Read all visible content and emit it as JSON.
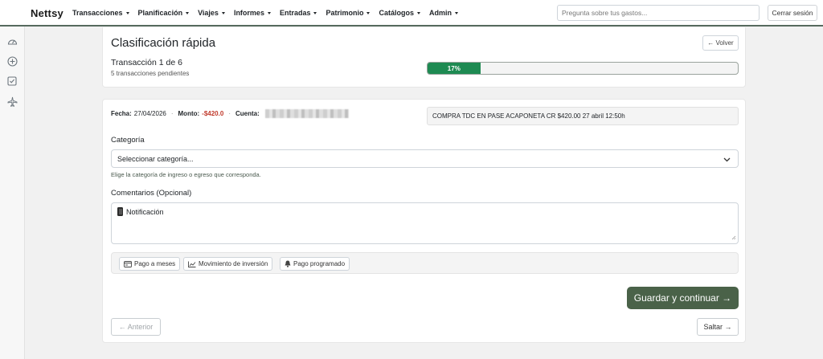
{
  "nav": {
    "brand": "Nettsy",
    "menu": [
      {
        "label": "Transacciones"
      },
      {
        "label": "Planificación"
      },
      {
        "label": "Viajes"
      },
      {
        "label": "Informes"
      },
      {
        "label": "Entradas"
      },
      {
        "label": "Patrimonio"
      },
      {
        "label": "Catálogos"
      },
      {
        "label": "Admin"
      }
    ],
    "search_placeholder": "Pregunta sobre tus gastos...",
    "logout_label": "Cerrar sesión"
  },
  "sidebar": {
    "icons": [
      "leaf-icon",
      "dashboard-gauge-icon",
      "plus-circle-icon",
      "check-square-icon",
      "airplane-icon"
    ]
  },
  "header_card": {
    "title": "Clasificación rápida",
    "back_label": "← Volver",
    "transaction_counter": "Transacción 1 de 6",
    "pending_text": "5 transacciones pendientes",
    "progress_percent": 17,
    "progress_label": "17%"
  },
  "transaction": {
    "date_label": "Fecha:",
    "date_value": "27/04/2026",
    "amount_label": "Monto:",
    "amount_value": "-$420.0",
    "account_label": "Cuenta:",
    "description": "COMPRA TDC EN PASE ACAPONETA CR $420.00 27 abril 12:50h",
    "amount_color": "#c0392b"
  },
  "form": {
    "category_label": "Categoría",
    "category_selected": "Seleccionar categoría...",
    "category_help": "Elige la categoría de ingreso o egreso que corresponda.",
    "comments_label": "Comentarios (Opcional)",
    "comments_value": "Notificación",
    "chips": [
      {
        "label": "Pago a meses",
        "icon": "calendar-card-icon"
      },
      {
        "label": "Movimiento de inversión",
        "icon": "chart-line-icon"
      },
      {
        "label": "Pago programado",
        "icon": "bell-icon"
      }
    ]
  },
  "actions": {
    "save_label": "Guardar y continuar →",
    "prev_label": "← Anterior",
    "skip_label": "Saltar →",
    "save_color": "#4a6249"
  }
}
